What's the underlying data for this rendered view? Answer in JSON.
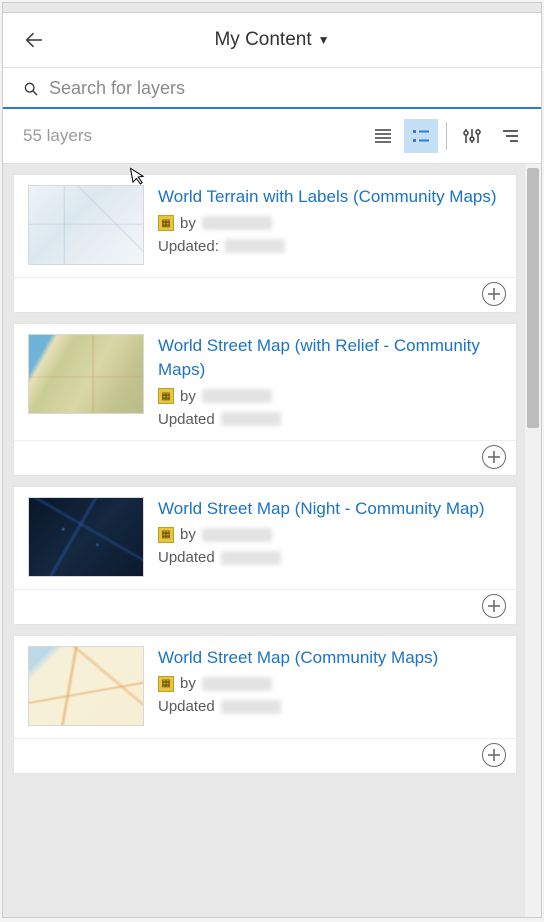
{
  "header": {
    "title": "My Content"
  },
  "search": {
    "placeholder": "Search for layers"
  },
  "toolbar": {
    "count": "55",
    "count_label": "layers"
  },
  "common": {
    "by_label": "by",
    "updated_label": "Updated:",
    "updated_label_alt": "Updated"
  },
  "items": [
    {
      "title": "World Terrain with Labels (Community Maps)",
      "thumb_class": "light-map",
      "updated_prefix_key": "common.updated_label"
    },
    {
      "title": "World Street Map (with Relief - Community Maps)",
      "thumb_class": "street-relief",
      "updated_prefix_key": "common.updated_label_alt"
    },
    {
      "title": "World Street Map (Night - Community Map)",
      "thumb_class": "night-map",
      "updated_prefix_key": "common.updated_label_alt"
    },
    {
      "title": "World Street Map (Community Maps)",
      "thumb_class": "street-comm",
      "updated_prefix_key": "common.updated_label_alt"
    }
  ]
}
